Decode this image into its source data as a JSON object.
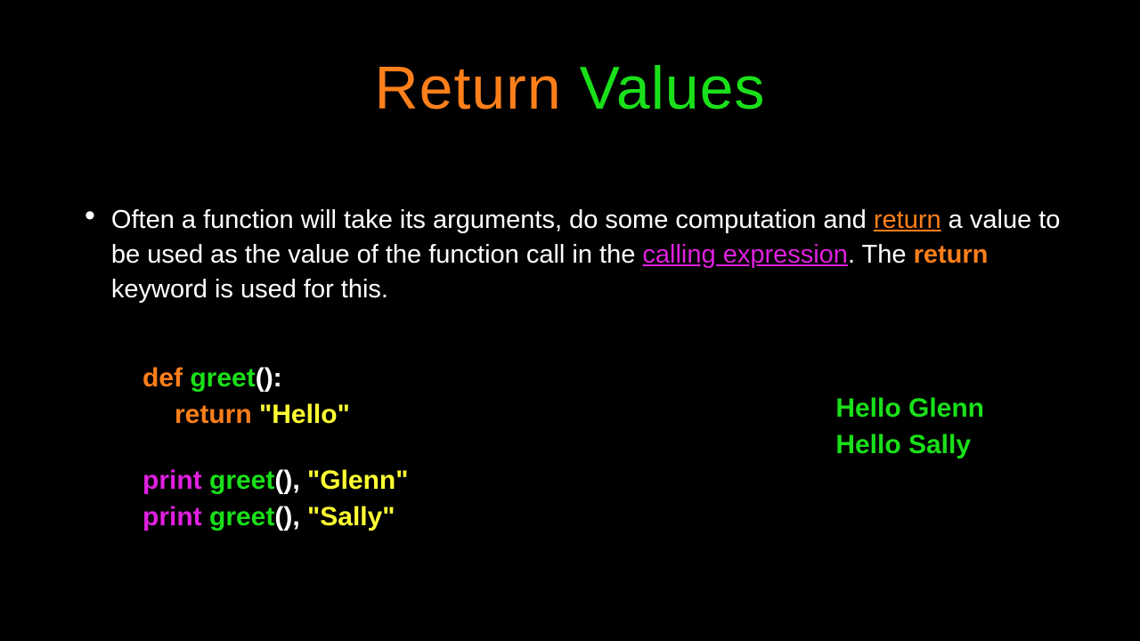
{
  "title": {
    "word1": "Return",
    "word2": "Values"
  },
  "bullet": {
    "part1": "Often a function will take its arguments, do some computation and ",
    "return_underline": "return",
    "part2": " a value to be used as the value of the function call in the ",
    "calling_expr": "calling expression",
    "part3": ".  The ",
    "return_bold": "return",
    "part4": " keyword is used for this."
  },
  "code": {
    "def": "def",
    "greet": "greet",
    "parens_colon": "():",
    "return_kw": "return",
    "hello_str": " \"Hello\"",
    "print": "print",
    "call_parens": "()",
    "comma": ",",
    "glenn_str": " \"Glenn\"",
    "sally_str": " \"Sally\""
  },
  "output": {
    "line1": "Hello Glenn",
    "line2": "Hello Sally"
  }
}
